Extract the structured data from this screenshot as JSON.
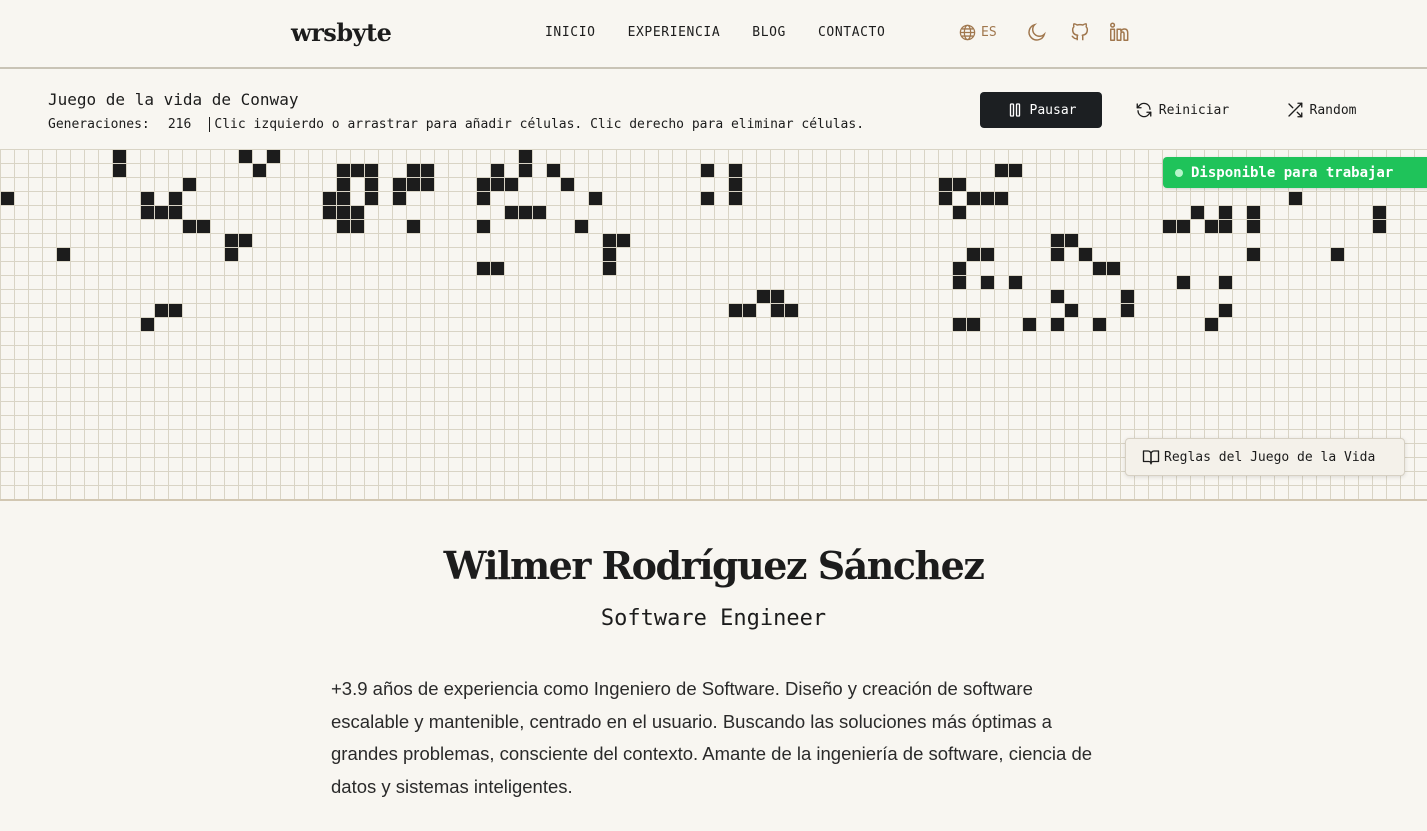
{
  "header": {
    "logo": "wrsbyte",
    "nav": [
      {
        "label": "INICIO"
      },
      {
        "label": "EXPERIENCIA"
      },
      {
        "label": "BLOG"
      },
      {
        "label": "CONTACTO"
      }
    ],
    "language": "ES",
    "icons": [
      "globe-icon",
      "moon-icon",
      "github-icon",
      "linkedin-icon"
    ],
    "accent_color": "#a0774e"
  },
  "game": {
    "title": "Juego de la vida de Conway",
    "generations_label": "Generaciones:",
    "generations": 216,
    "hint": "Clic izquierdo o arrastrar para añadir células. Clic derecho para eliminar células.",
    "pause_label": "Pausar",
    "reset_label": "Reiniciar",
    "random_label": "Random",
    "rules_label": "Reglas del Juego de la Vida",
    "badge_label": "Disponible para trabajar",
    "badge_color": "#1fc35a",
    "grid": {
      "cols": 102,
      "rows": 25,
      "line_color": "#d9d4c5",
      "cell_color": "#1c1c1c",
      "pattern": [
        "........#........#.#.................#.............................................................",
        "........#.........#.....###..##....#.#.#..........#.#..................##................#.........",
        ".............#..........#.#.###...###...#...........#..............##..............................",
        "#.........#.#..........##.#.#.....#.......#.......#.#..............#.###....................#......",
        "..........###..........###..........###.............................#................#.#.#........#",
        ".............##.........##...#....#......#.........................................##.##.#........#",
        "................##.........................##..............................##.....................",
        "....#...........#..........................#.........................##....#.#...........#.....#..",
        "..................................##.......#........................#.........##.................",
        "....................................................................#.#.#...........#..#..........",
        "......................................................##...................#....#...............",
        "...........##.......................................##.##...................#...#......#..........",
        "..........#.........................................................##...#.#..#.......#..........",
        "....................................................................................................",
        "....................................................................................................",
        "....................................................................................................",
        "....................................................................................................",
        "....................................................................................................",
        "....................................................................................................",
        "....................................................................................................",
        "....................................................................................................",
        "....................................................................................................",
        "....................................................................................................",
        "....................................................................................................",
        "...................................................................................................."
      ]
    }
  },
  "hero": {
    "name": "Wilmer Rodríguez Sánchez",
    "role": "Software Engineer",
    "bio": "+3.9 años de experiencia como Ingeniero de Software. Diseño y creación de software escalable y mantenible, centrado en el usuario. Buscando las soluciones más óptimas a grandes problemas, consciente del contexto. Amante de la ingeniería de software, ciencia de datos y sistemas inteligentes."
  }
}
